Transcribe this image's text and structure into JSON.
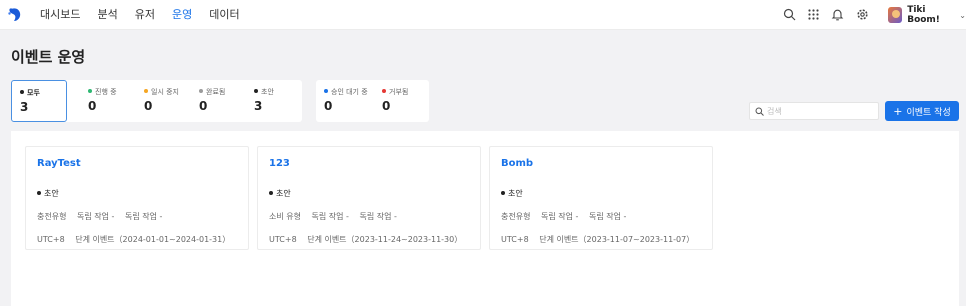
{
  "nav": {
    "items": [
      {
        "label": "대시보드",
        "active": false
      },
      {
        "label": "분석",
        "active": false
      },
      {
        "label": "유저",
        "active": false
      },
      {
        "label": "운영",
        "active": true
      },
      {
        "label": "데이터",
        "active": false
      }
    ]
  },
  "user": {
    "name": "Tiki Boom!"
  },
  "page": {
    "title": "이벤트 운영"
  },
  "filters": {
    "group1": [
      {
        "label": "모두",
        "value": "3",
        "color": "#222222",
        "selected": true
      },
      {
        "label": "진행 중",
        "value": "0",
        "color": "#2eb872"
      },
      {
        "label": "일시 중지",
        "value": "0",
        "color": "#f5a623"
      },
      {
        "label": "완료됨",
        "value": "0",
        "color": "#9b9b9b"
      },
      {
        "label": "초안",
        "value": "3",
        "color": "#222222"
      }
    ],
    "group2": [
      {
        "label": "승인 대기 중",
        "value": "0",
        "color": "#1a73e8"
      },
      {
        "label": "거부됨",
        "value": "0",
        "color": "#e53935"
      }
    ]
  },
  "search": {
    "placeholder": "검색"
  },
  "create_button": {
    "label": "이벤트 작성"
  },
  "cards": [
    {
      "title": "RayTest",
      "status": "초안",
      "type": "충전유형",
      "tag1": "독립 작업 -",
      "tag2": "독립 작업 -",
      "tz": "UTC+8",
      "period": "단계 이벤트（2024-01-01~2024-01-31）"
    },
    {
      "title": "123",
      "status": "초안",
      "type": "소비 유형",
      "tag1": "독립 작업 -",
      "tag2": "독립 작업 -",
      "tz": "UTC+8",
      "period": "단계 이벤트（2023-11-24~2023-11-30）"
    },
    {
      "title": "Bomb",
      "status": "초안",
      "type": "충전유형",
      "tag1": "독립 작업 -",
      "tag2": "독립 작업 -",
      "tz": "UTC+8",
      "period": "단계 이벤트（2023-11-07~2023-11-07）"
    }
  ],
  "colors": {
    "accent": "#1a73e8",
    "background": "#f2f2f4"
  }
}
